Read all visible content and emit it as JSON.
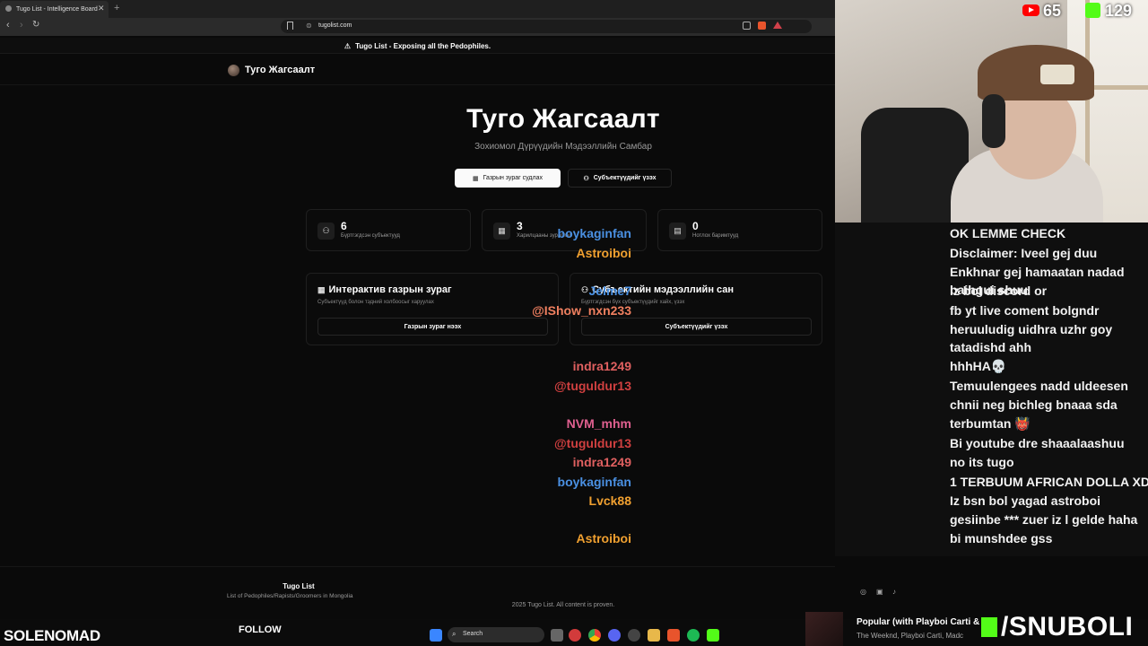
{
  "browser": {
    "tab_title": "Tugo List - Intelligence Board",
    "tab_close": "✕",
    "new_tab": "+",
    "url": "tugolist.com"
  },
  "page": {
    "banner": "Tugo List - Exposing all the Pedophiles.",
    "logo": "Туго Жагсаалт",
    "hero_title": "Туго Жагсаалт",
    "hero_subtitle": "Зохиомол Дүрүүдийн Мэдээллийн Самбар",
    "btn_map": "Газрын зураг судлах",
    "btn_subjects": "Субъектүүдийг үзэх",
    "stats": [
      {
        "value": "6",
        "label": "Бүртгэгдсэн субъектууд",
        "icon": "users-icon"
      },
      {
        "value": "3",
        "label": "Харилцааны зураглал",
        "icon": "map-icon"
      },
      {
        "value": "0",
        "label": "Нотлох баримтууд",
        "icon": "file-icon"
      }
    ],
    "cards": [
      {
        "title": "Интерактив газрын зураг",
        "desc": "Субъектүүд болон тэдний холбоосыг харуулах",
        "button": "Газрын зураг нээх",
        "icon": "map-icon"
      },
      {
        "title": "Субъектийн мэдээллийн сан",
        "desc": "Бүртгэгдсэн бүх субъектүүдийг хайх, үзэх",
        "button": "Субъектүүдийг үзэх",
        "icon": "users-icon"
      }
    ],
    "footer_brand": "Tugo List",
    "footer_desc": "List of Pedophiles/Rapists/Groomers in Mongolia",
    "footer_copy": "2025 Tugo List. All content is proven."
  },
  "overlay": {
    "youtube_count": "65",
    "kick_count": "129",
    "streamer": "SOLENOMAD",
    "follow": "FOLLOW",
    "search": "Search",
    "music_title": "Popular (with Playboi Carti &",
    "music_artist": "The Weeknd, Playboi Carti, Madc",
    "brand": "/SNUBOLI",
    "colors": {
      "youtube": "#ff0000",
      "kick": "#53fc18"
    }
  },
  "chat": [
    {
      "user": "boykaginfan",
      "color": "#4a90e2",
      "text": "OK LEMME CHECK"
    },
    {
      "user": "Astroiboi",
      "color": "#f0a030",
      "text": "Disclaimer: Iveel gej duu Enkhnar gej hamaatan nadad baihgui shuu"
    },
    {
      "user": "Jelme7",
      "color": "#4a90e2",
      "text": "iz bol discord or"
    },
    {
      "user": "@IShow_nxn233",
      "color": "#f08060",
      "text": "fb yt live coment bolgndr heruuludig uidhra uzhr goy tatadishd ahh"
    },
    {
      "user": "indra1249",
      "color": "#e06060",
      "text": "hhhHA💀"
    },
    {
      "user": "@tuguldur13",
      "color": "#d04040",
      "text": "Temuulengees nadd uldeesen chnii neg bichleg bnaaa sda"
    },
    {
      "user": "NVM_mhm",
      "color": "#e06090",
      "text": "terbumtan 👹"
    },
    {
      "user": "@tuguldur13",
      "color": "#d04040",
      "text": "Bi youtube dre shaaalaashuu"
    },
    {
      "user": "indra1249",
      "color": "#e06060",
      "text": "no its tugo"
    },
    {
      "user": "boykaginfan",
      "color": "#4a90e2",
      "text": "1 TERBUUM AFRICAN DOLLA XD"
    },
    {
      "user": "Lvck88",
      "color": "#f0a030",
      "text": "Iz bsn bol yagad astroboi gesiinbe *** zuer iz l gelde haha"
    },
    {
      "user": "Astroiboi",
      "color": "#f0a030",
      "text": "bi munshdee gss"
    }
  ]
}
